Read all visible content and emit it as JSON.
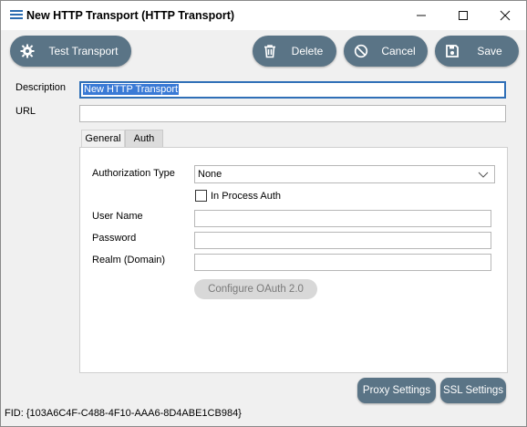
{
  "window": {
    "title": "New HTTP Transport (HTTP Transport)",
    "app_icon": "hamburger-menu-icon",
    "controls": [
      "minimize-icon",
      "maximize-icon",
      "close-icon"
    ]
  },
  "toolbar": {
    "test_label": "Test Transport",
    "test_icon": "gear-icon",
    "delete_label": "Delete",
    "delete_icon": "trash-icon",
    "cancel_label": "Cancel",
    "cancel_icon": "prohibited-icon",
    "save_label": "Save",
    "save_icon": "floppy-disk-icon",
    "button_color": "#5a7486"
  },
  "form": {
    "description_label": "Description",
    "description_value": "New HTTP Transport",
    "url_label": "URL",
    "url_value": ""
  },
  "tabs": [
    {
      "label": "General",
      "active": false
    },
    {
      "label": "Auth",
      "active": true
    }
  ],
  "auth": {
    "auth_type_label": "Authorization Type",
    "auth_type_value": "None",
    "in_process_label": "In Process Auth",
    "in_process_checked": false,
    "username_label": "User Name",
    "username_value": "",
    "password_label": "Password",
    "password_value": "",
    "realm_label": "Realm (Domain)",
    "realm_value": "",
    "oauth_label": "Configure OAuth 2.0"
  },
  "footer": {
    "proxy_label": "Proxy Settings",
    "ssl_label": "SSL Settings",
    "fid_text": "FID: {103A6C4F-C488-4F10-AAA6-8D4ABE1CB984}"
  }
}
